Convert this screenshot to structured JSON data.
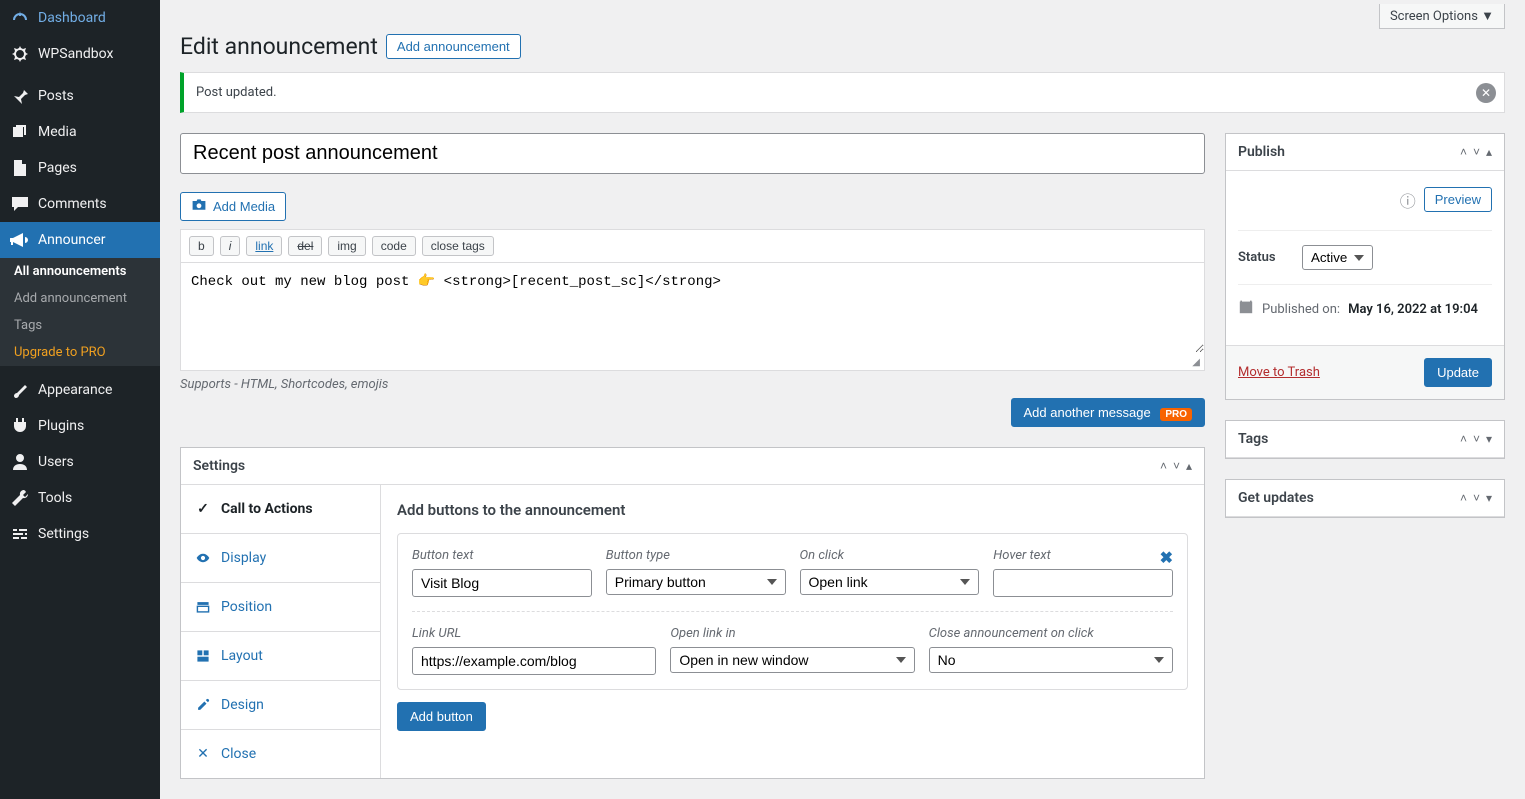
{
  "screen_options": "Screen Options ▼",
  "sidebar": [
    {
      "ico": "dash",
      "label": "Dashboard"
    },
    {
      "ico": "sandbox",
      "label": "WPSandbox"
    },
    {
      "sep": true
    },
    {
      "ico": "pin",
      "label": "Posts"
    },
    {
      "ico": "media",
      "label": "Media"
    },
    {
      "ico": "page",
      "label": "Pages"
    },
    {
      "ico": "comment",
      "label": "Comments"
    },
    {
      "ico": "announce",
      "label": "Announcer",
      "active": true,
      "subs": [
        {
          "label": "All announcements",
          "strong": true
        },
        {
          "label": "Add announcement"
        },
        {
          "label": "Tags"
        },
        {
          "label": "Upgrade to PRO",
          "pro": true
        }
      ]
    },
    {
      "sep": true
    },
    {
      "ico": "appearance",
      "label": "Appearance"
    },
    {
      "ico": "plugin",
      "label": "Plugins"
    },
    {
      "ico": "users",
      "label": "Users"
    },
    {
      "ico": "tools",
      "label": "Tools"
    },
    {
      "ico": "settings",
      "label": "Settings"
    }
  ],
  "page": {
    "title": "Edit announcement",
    "add_btn": "Add announcement",
    "notice": "Post updated.",
    "post_title": "Recent post announcement",
    "add_media": "Add Media",
    "qtags": {
      "b": "b",
      "i": "i",
      "link": "link",
      "del": "del",
      "img": "img",
      "code": "code",
      "close": "close tags"
    },
    "editor_content": "Check out my new blog post 👉 <strong>[recent_post_sc]</strong>",
    "editor_support": "Supports - HTML, Shortcodes, emojis",
    "add_another_msg": "Add another message",
    "pro_badge": "PRO"
  },
  "settings_panel": {
    "title": "Settings",
    "tabs": {
      "cta": "Call to Actions",
      "display": "Display",
      "position": "Position",
      "layout": "Layout",
      "design": "Design",
      "close": "Close"
    },
    "cta": {
      "title": "Add buttons to the announcement",
      "labels": {
        "button_text": "Button text",
        "button_type": "Button type",
        "on_click": "On click",
        "hover_text": "Hover text",
        "link_url": "Link URL",
        "open_link_in": "Open link in",
        "close_on_click": "Close announcement on click"
      },
      "values": {
        "button_text": "Visit Blog",
        "button_type": "Primary button",
        "on_click": "Open link",
        "hover_text": "",
        "link_url": "https://example.com/blog",
        "open_link_in": "Open in new window",
        "close_on_click": "No"
      },
      "add_button": "Add button"
    }
  },
  "publish": {
    "title": "Publish",
    "preview": "Preview",
    "status_label": "Status",
    "status_value": "Active",
    "published_on_label": "Published on:",
    "published_on_value": "May 16, 2022 at 19:04",
    "trash": "Move to Trash",
    "update": "Update"
  },
  "panels": {
    "tags": "Tags",
    "get_updates": "Get updates"
  }
}
